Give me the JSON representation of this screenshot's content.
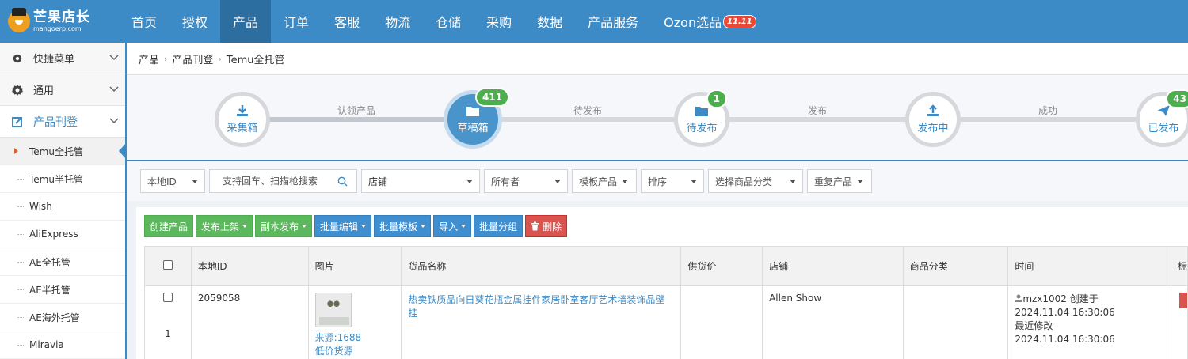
{
  "logo": {
    "title": "芒果店长",
    "subtitle": "mangoerp.com"
  },
  "topnav": {
    "items": [
      "首页",
      "授权",
      "产品",
      "订单",
      "客服",
      "物流",
      "仓储",
      "采购",
      "数据",
      "产品服务",
      "Ozon选品"
    ],
    "active_index": 2,
    "hot_badge": "11.11"
  },
  "sidebar": {
    "groups": [
      {
        "label": "快捷菜单",
        "icon": "gear-icon"
      },
      {
        "label": "通用",
        "icon": "gear-icon"
      },
      {
        "label": "产品刊登",
        "icon": "edit-icon"
      }
    ],
    "items": [
      "Temu全托管",
      "Temu半托管",
      "Wish",
      "AliExpress",
      "AE全托管",
      "AE半托管",
      "AE海外托管",
      "Miravia"
    ],
    "active_item": "Temu全托管"
  },
  "breadcrumb": [
    "产品",
    "产品刊登",
    "Temu全托管"
  ],
  "steps": {
    "nodes": [
      {
        "label": "采集箱",
        "icon": "download-icon",
        "count": ""
      },
      {
        "label": "草稿箱",
        "icon": "folder-icon",
        "count": "411"
      },
      {
        "label": "待发布",
        "icon": "folder-icon",
        "count": "1"
      },
      {
        "label": "发布中",
        "icon": "upload-icon",
        "count": ""
      },
      {
        "label": "已发布",
        "icon": "send-icon",
        "count": "43"
      }
    ],
    "connectors": [
      "认领产品",
      "待发布",
      "发布",
      "成功"
    ],
    "current_index": 1
  },
  "filters": {
    "id_type": "本地ID",
    "search_placeholder": "支持回车、扫描枪搜索",
    "shop": "店铺",
    "owner": "所有者",
    "template": "模板产品",
    "sort": "排序",
    "category": "选择商品分类",
    "duplicate": "重复产品"
  },
  "actions": {
    "create": "创建产品",
    "publish": "发布上架",
    "copy_publish": "副本发布",
    "batch_edit": "批量编辑",
    "batch_template": "批量模板",
    "import": "导入",
    "batch_group": "批量分组",
    "delete": "删除"
  },
  "table": {
    "headers": [
      "本地ID",
      "图片",
      "货品名称",
      "供货价",
      "店铺",
      "商品分类",
      "时间",
      "标"
    ],
    "rows": [
      {
        "index": "1",
        "id": "2059058",
        "source": "来源:1688",
        "source_note": "低价货源",
        "name": "热卖铁质品向日葵花瓶金属挂件家居卧室客厅艺术墙装饰品壁挂",
        "price": "",
        "shop": "Allen Show",
        "category": "",
        "creator": "mzx1002 创建于",
        "created": "2024.11.04 16:30:06",
        "modified_label": "最近修改",
        "modified": "2024.11.04 16:30:06"
      }
    ]
  }
}
